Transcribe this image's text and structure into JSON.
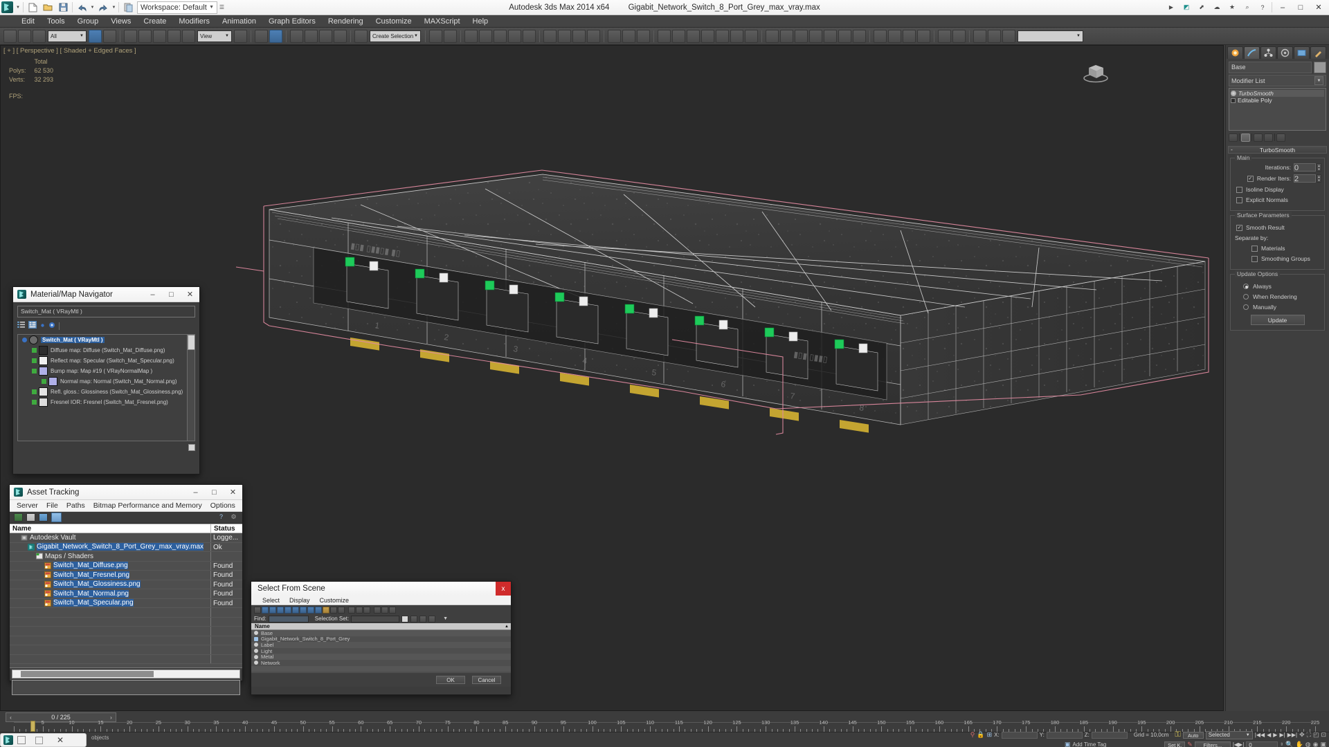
{
  "titlebar": {
    "app": "Autodesk 3ds Max  2014 x64",
    "file": "Gigabit_Network_Switch_8_Port_Grey_max_vray.max",
    "workspace": "Workspace: Default",
    "min": "–",
    "max": "□",
    "close": "✕"
  },
  "menu": [
    "Edit",
    "Tools",
    "Group",
    "Views",
    "Create",
    "Modifiers",
    "Animation",
    "Graph Editors",
    "Rendering",
    "Customize",
    "MAXScript",
    "Help"
  ],
  "toolbar": {
    "filter_all": "All",
    "view_coord": "View",
    "named_selection": "Create Selection",
    "render_preset": ""
  },
  "viewport": {
    "label": "[ + ] [ Perspective ] [ Shaded + Edged Faces ]",
    "stats_header": "Total",
    "polys_label": "Polys:",
    "polys_value": "62 530",
    "verts_label": "Verts:",
    "verts_value": "32 293",
    "fps_label": "FPS:"
  },
  "command_panel": {
    "object_name": "Base",
    "modifier_list": "Modifier List",
    "stack": [
      {
        "label": "TurboSmooth",
        "italic": true
      },
      {
        "label": "Editable Poly",
        "italic": false
      }
    ],
    "rollout_title": "TurboSmooth",
    "group_main": "Main",
    "iterations_label": "Iterations:",
    "iterations_value": "0",
    "render_iters_label": "Render Iters:",
    "render_iters_value": "2",
    "isoline_display": "Isoline Display",
    "explicit_normals": "Explicit Normals",
    "group_surface": "Surface Parameters",
    "smooth_result": "Smooth Result",
    "separate_by": "Separate by:",
    "materials": "Materials",
    "smoothing_groups": "Smoothing Groups",
    "group_update": "Update Options",
    "always": "Always",
    "when_rendering": "When Rendering",
    "manually": "Manually",
    "update_button": "Update"
  },
  "material_navigator": {
    "title": "Material/Map Navigator",
    "min": "–",
    "max": "□",
    "close": "✕",
    "current": "Switch_Mat  ( VRayMtl )",
    "tree": [
      {
        "label": "Switch_Mat  ( VRayMtl )",
        "indent": 0,
        "selected": true,
        "swatch": "#6b6b6b"
      },
      {
        "label": "Diffuse map: Diffuse (Switch_Mat_Diffuse.png)",
        "indent": 1,
        "selected": false,
        "swatch": "#2e2e2e"
      },
      {
        "label": "Reflect map: Specular (Switch_Mat_Specular.png)",
        "indent": 1,
        "selected": false,
        "swatch": "#f0f0f0"
      },
      {
        "label": "Bump map: Map #19  ( VRayNormalMap )",
        "indent": 1,
        "selected": false,
        "swatch": "#b0b0e8"
      },
      {
        "label": "Normal map: Normal (Switch_Mat_Normal.png)",
        "indent": 2,
        "selected": false,
        "swatch": "#b0b0e8"
      },
      {
        "label": "Refl. gloss.: Glossiness (Switch_Mat_Glossiness.png)",
        "indent": 1,
        "selected": false,
        "swatch": "#e4e4e4"
      },
      {
        "label": "Fresnel IOR: Fresnel (Switch_Mat_Fresnel.png)",
        "indent": 1,
        "selected": false,
        "swatch": "#dcdcdc"
      }
    ]
  },
  "asset_tracking": {
    "title": "Asset Tracking",
    "min": "–",
    "max": "□",
    "close": "✕",
    "menu": [
      "Server",
      "File",
      "Paths",
      "Bitmap Performance and Memory",
      "Options"
    ],
    "columns": [
      "Name",
      "Status"
    ],
    "rows": [
      {
        "name": "Autodesk Vault",
        "status": "Logge...",
        "indent": 0,
        "icon": "vault",
        "highlight": false
      },
      {
        "name": "Gigabit_Network_Switch_8_Port_Grey_max_vray.max",
        "status": "Ok",
        "indent": 1,
        "icon": "max",
        "highlight": true
      },
      {
        "name": "Maps / Shaders",
        "status": "",
        "indent": 2,
        "icon": "folder",
        "highlight": false
      },
      {
        "name": "Switch_Mat_Diffuse.png",
        "status": "Found",
        "indent": 3,
        "icon": "png",
        "highlight": true
      },
      {
        "name": "Switch_Mat_Fresnel.png",
        "status": "Found",
        "indent": 3,
        "icon": "png",
        "highlight": true
      },
      {
        "name": "Switch_Mat_Glossiness.png",
        "status": "Found",
        "indent": 3,
        "icon": "png",
        "highlight": true
      },
      {
        "name": "Switch_Mat_Normal.png",
        "status": "Found",
        "indent": 3,
        "icon": "png",
        "highlight": true
      },
      {
        "name": "Switch_Mat_Specular.png",
        "status": "Found",
        "indent": 3,
        "icon": "png",
        "highlight": true
      }
    ]
  },
  "select_from_scene": {
    "title": "Select From Scene",
    "close": "x",
    "menu": [
      "Select",
      "Display",
      "Customize"
    ],
    "find_label": "Find:",
    "find_value": "",
    "selection_set_label": "Selection Set:",
    "selection_set_value": "",
    "column_name": "Name",
    "items": [
      {
        "name": "Base",
        "type": "geom"
      },
      {
        "name": "Gigabit_Network_Switch_8_Port_Grey",
        "type": "group"
      },
      {
        "name": "Label",
        "type": "geom"
      },
      {
        "name": "Light",
        "type": "geom"
      },
      {
        "name": "Metal",
        "type": "geom"
      },
      {
        "name": "Network",
        "type": "geom"
      }
    ],
    "ok": "OK",
    "cancel": "Cancel"
  },
  "timeline": {
    "frame_display": "0 / 225",
    "prev": "‹",
    "next": "›",
    "ticks": [
      0,
      5,
      10,
      15,
      20,
      25,
      30,
      35,
      40,
      45,
      50,
      55,
      60,
      65,
      70,
      75,
      80,
      85,
      90,
      95,
      100,
      105,
      110,
      115,
      120,
      125,
      130,
      135,
      140,
      145,
      150,
      155,
      160,
      165,
      170,
      175,
      180,
      185,
      190,
      195,
      200,
      205,
      210,
      215,
      220,
      225
    ]
  },
  "statusbar": {
    "prompt": "objects",
    "x_label": "X:",
    "y_label": "Y:",
    "z_label": "Z:",
    "x_value": "",
    "y_value": "",
    "z_value": "",
    "grid": "Grid = 10,0cm",
    "add_time_tag": "Add Time Tag",
    "auto_key": "Auto",
    "set_key": "Set K.",
    "selected": "Selected",
    "filters": "Filters...",
    "key_field": "0"
  },
  "taskbar": {
    "close": "✕",
    "sq": "□"
  },
  "colors": {
    "accent_blue": "#2c5f9e",
    "selection_pink": "#e08aa0",
    "vp_text": "#b0a27a",
    "panel_bg": "#3c3c3c",
    "found_status": "#e8e8e8"
  }
}
